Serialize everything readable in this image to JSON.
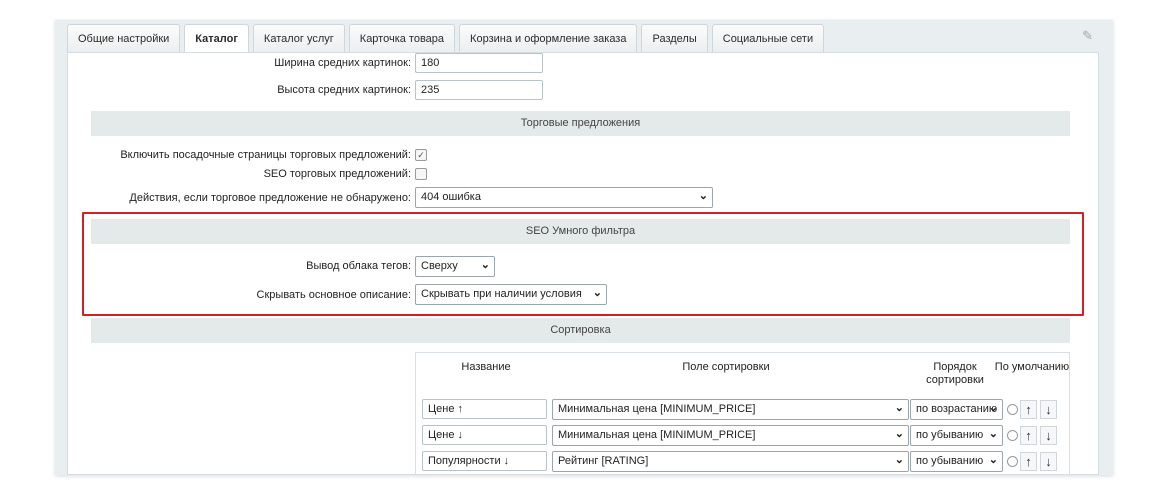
{
  "tabs": [
    "Общие настройки",
    "Каталог",
    "Каталог услуг",
    "Карточка товара",
    "Корзина и оформление заказа",
    "Разделы",
    "Социальные сети"
  ],
  "active_tab": "Каталог",
  "fields": {
    "mid_width_label": "Ширина средних картинок:",
    "mid_width_value": "180",
    "mid_height_label": "Высота средних картинок:",
    "mid_height_value": "235"
  },
  "offers": {
    "title": "Торговые предложения",
    "landing_label": "Включить посадочные страницы торговых предложений:",
    "landing_checked": true,
    "seo_label": "SEO торговых предложений:",
    "seo_checked": false,
    "notfound_label": "Действия, если торговое предложение не обнаружено:",
    "notfound_value": "404 ошибка"
  },
  "seo_filter": {
    "title": "SEO Умного фильтра",
    "tags_label": "Вывод облака тегов:",
    "tags_value": "Сверху",
    "hide_label": "Скрывать основное описание:",
    "hide_value": "Скрывать при наличии условия"
  },
  "sorting": {
    "title": "Сортировка",
    "headers": {
      "name": "Название",
      "field": "Поле сортировки",
      "order": "Порядок сортировки",
      "default": "По умолчанию"
    },
    "rows": [
      {
        "name": "Цене ↑",
        "field": "Минимальная цена [MINIMUM_PRICE]",
        "order": "по возрастанию"
      },
      {
        "name": "Цене ↓",
        "field": "Минимальная цена [MINIMUM_PRICE]",
        "order": "по убыванию"
      },
      {
        "name": "Популярности ↓",
        "field": "Рейтинг [RATING]",
        "order": "по убыванию"
      }
    ]
  },
  "colors": {
    "highlight": "#d32027",
    "section_bg": "#e4e9ea"
  }
}
